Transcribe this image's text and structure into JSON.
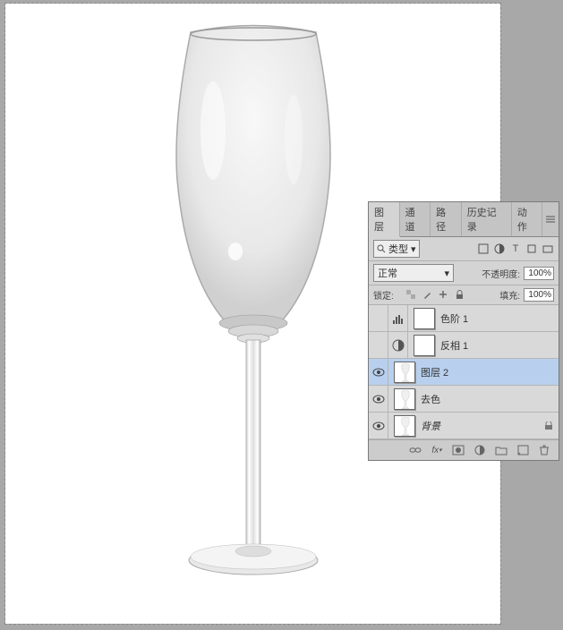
{
  "panel": {
    "tabs": [
      "图层",
      "通道",
      "路径",
      "历史记录",
      "动作"
    ],
    "active_tab": 0,
    "filter_label": "类型",
    "blend_mode": "正常",
    "opacity_label": "不透明度:",
    "opacity_value": "100%",
    "lock_label": "锁定:",
    "fill_label": "填充:",
    "fill_value": "100%"
  },
  "layers": [
    {
      "name": "色阶 1",
      "visible": false,
      "type": "adjustment-levels",
      "selected": false,
      "has_mask": true
    },
    {
      "name": "反相 1",
      "visible": false,
      "type": "adjustment-invert",
      "selected": false,
      "has_mask": true
    },
    {
      "name": "图层 2",
      "visible": true,
      "type": "pixel",
      "selected": true,
      "has_mask": false
    },
    {
      "name": "去色",
      "visible": true,
      "type": "pixel",
      "selected": false,
      "has_mask": false
    },
    {
      "name": "背景",
      "visible": true,
      "type": "background",
      "selected": false,
      "has_mask": false,
      "locked": true
    }
  ]
}
